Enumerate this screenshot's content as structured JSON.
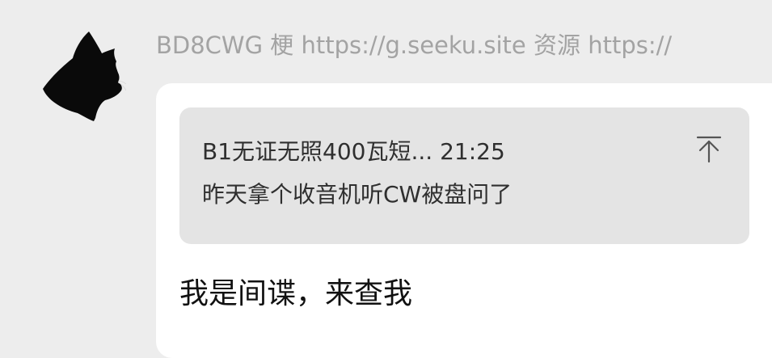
{
  "message": {
    "sender_name": "BD8CWG 梗 https://g.seeku.site  资源 https://",
    "quote": {
      "title": "B1无证无照400瓦短... 21:25",
      "text": "昨天拿个收音机听CW被盘问了",
      "jump_icon": "arrow-up-to-top-icon"
    },
    "text": "我是间谍，来查我"
  },
  "colors": {
    "background": "#ededed",
    "bubble": "#ffffff",
    "quote_background": "#e4e4e4",
    "sender_name": "#a3a3a3"
  }
}
